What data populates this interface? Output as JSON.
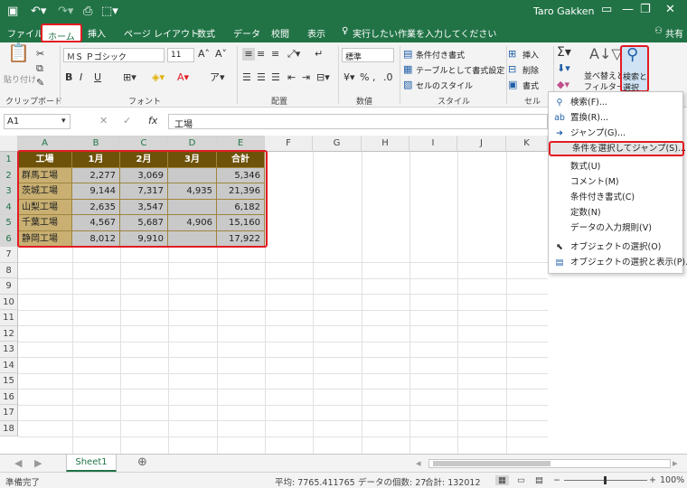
{
  "titlebar": {
    "user": "Taro Gakken",
    "save_icon": "save-icon",
    "undo_icon": "undo-icon",
    "redo_icon": "redo-icon"
  },
  "tabs": [
    "ファイル",
    "ホーム",
    "挿入",
    "ページ レイアウト",
    "数式",
    "データ",
    "校閲",
    "表示"
  ],
  "tellme": "実行したい作業を入力してください",
  "share": "共有",
  "ribbon": {
    "clipboard": {
      "paste": "貼り付け",
      "label": "クリップボード"
    },
    "font": {
      "name": "ＭＳ Ｐゴシック",
      "size": "11",
      "label": "フォント"
    },
    "align": {
      "label": "配置"
    },
    "number": {
      "format": "標準",
      "label": "数値"
    },
    "style": {
      "cond": "条件付き書式",
      "table": "テーブルとして書式設定",
      "cell": "セルのスタイル",
      "label": "スタイル"
    },
    "cells": {
      "insert": "挿入",
      "delete": "削除",
      "format": "書式",
      "label": "セル"
    },
    "edit": {
      "sort1": "並べ替えと",
      "sort2": "フィルター",
      "find1": "検索と",
      "find2": "選択"
    }
  },
  "formula": {
    "namebox": "A1",
    "fx": "fx",
    "content": "工場"
  },
  "columns": [
    "A",
    "B",
    "C",
    "D",
    "E",
    "F",
    "G",
    "H",
    "I",
    "J",
    "K"
  ],
  "rows": [
    "1",
    "2",
    "3",
    "4",
    "5",
    "6",
    "7",
    "8",
    "9",
    "10",
    "11",
    "12",
    "13",
    "14",
    "15",
    "16",
    "17",
    "18"
  ],
  "table": {
    "header": [
      "工場",
      "1月",
      "2月",
      "3月",
      "合計"
    ],
    "rows": [
      [
        "群馬工場",
        "2,277",
        "3,069",
        "",
        "5,346"
      ],
      [
        "茨城工場",
        "9,144",
        "7,317",
        "4,935",
        "21,396"
      ],
      [
        "山梨工場",
        "2,635",
        "3,547",
        "",
        "6,182"
      ],
      [
        "千葉工場",
        "4,567",
        "5,687",
        "4,906",
        "15,160"
      ],
      [
        "静岡工場",
        "8,012",
        "9,910",
        "",
        "17,922"
      ]
    ]
  },
  "menu": [
    {
      "label": "検索(F)...",
      "icon": "search-icon"
    },
    {
      "label": "置換(R)...",
      "icon": "replace-icon"
    },
    {
      "label": "ジャンプ(G)...",
      "icon": "arrow-right-icon"
    },
    {
      "label": "条件を選択してジャンプ(S)...",
      "icon": ""
    },
    {
      "label": "数式(U)",
      "icon": ""
    },
    {
      "label": "コメント(M)",
      "icon": ""
    },
    {
      "label": "条件付き書式(C)",
      "icon": ""
    },
    {
      "label": "定数(N)",
      "icon": ""
    },
    {
      "label": "データの入力規則(V)",
      "icon": ""
    },
    {
      "label": "オブジェクトの選択(O)",
      "icon": "cursor-icon"
    },
    {
      "label": "オブジェクトの選択と表示(P)...",
      "icon": "selection-pane-icon"
    }
  ],
  "sheet": {
    "tab": "Sheet1"
  },
  "status": {
    "ready": "準備完了",
    "avg": "平均: 7765.411765",
    "count": "データの個数: 27",
    "sum": "合計: 132012",
    "zoom": "100%"
  }
}
